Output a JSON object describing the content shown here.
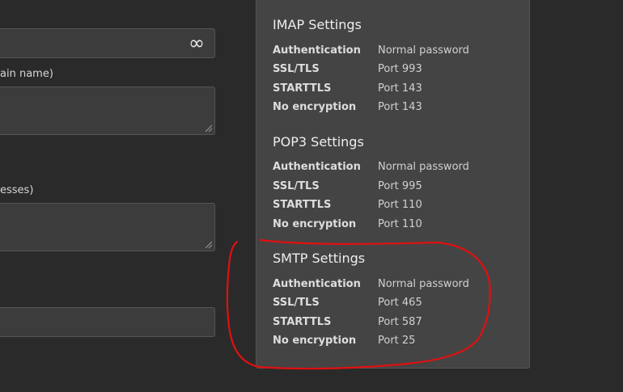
{
  "form": {
    "infinity_symbol": "∞",
    "hints": [
      "ain name)",
      "esses)"
    ]
  },
  "settings": {
    "sections": [
      {
        "title": "IMAP Settings",
        "rows": [
          {
            "key": "Authentication",
            "value": "Normal password"
          },
          {
            "key": "SSL/TLS",
            "value": "Port 993"
          },
          {
            "key": "STARTTLS",
            "value": "Port 143"
          },
          {
            "key": "No encryption",
            "value": "Port 143"
          }
        ]
      },
      {
        "title": "POP3 Settings",
        "rows": [
          {
            "key": "Authentication",
            "value": "Normal password"
          },
          {
            "key": "SSL/TLS",
            "value": "Port 995"
          },
          {
            "key": "STARTTLS",
            "value": "Port 110"
          },
          {
            "key": "No encryption",
            "value": "Port 110"
          }
        ]
      },
      {
        "title": "SMTP Settings",
        "rows": [
          {
            "key": "Authentication",
            "value": "Normal password"
          },
          {
            "key": "SSL/TLS",
            "value": "Port 465"
          },
          {
            "key": "STARTTLS",
            "value": "Port 587"
          },
          {
            "key": "No encryption",
            "value": "Port 25"
          }
        ]
      }
    ]
  },
  "colors": {
    "background": "#2a2a2a",
    "panel": "#444444",
    "annotation": "#e01010"
  }
}
